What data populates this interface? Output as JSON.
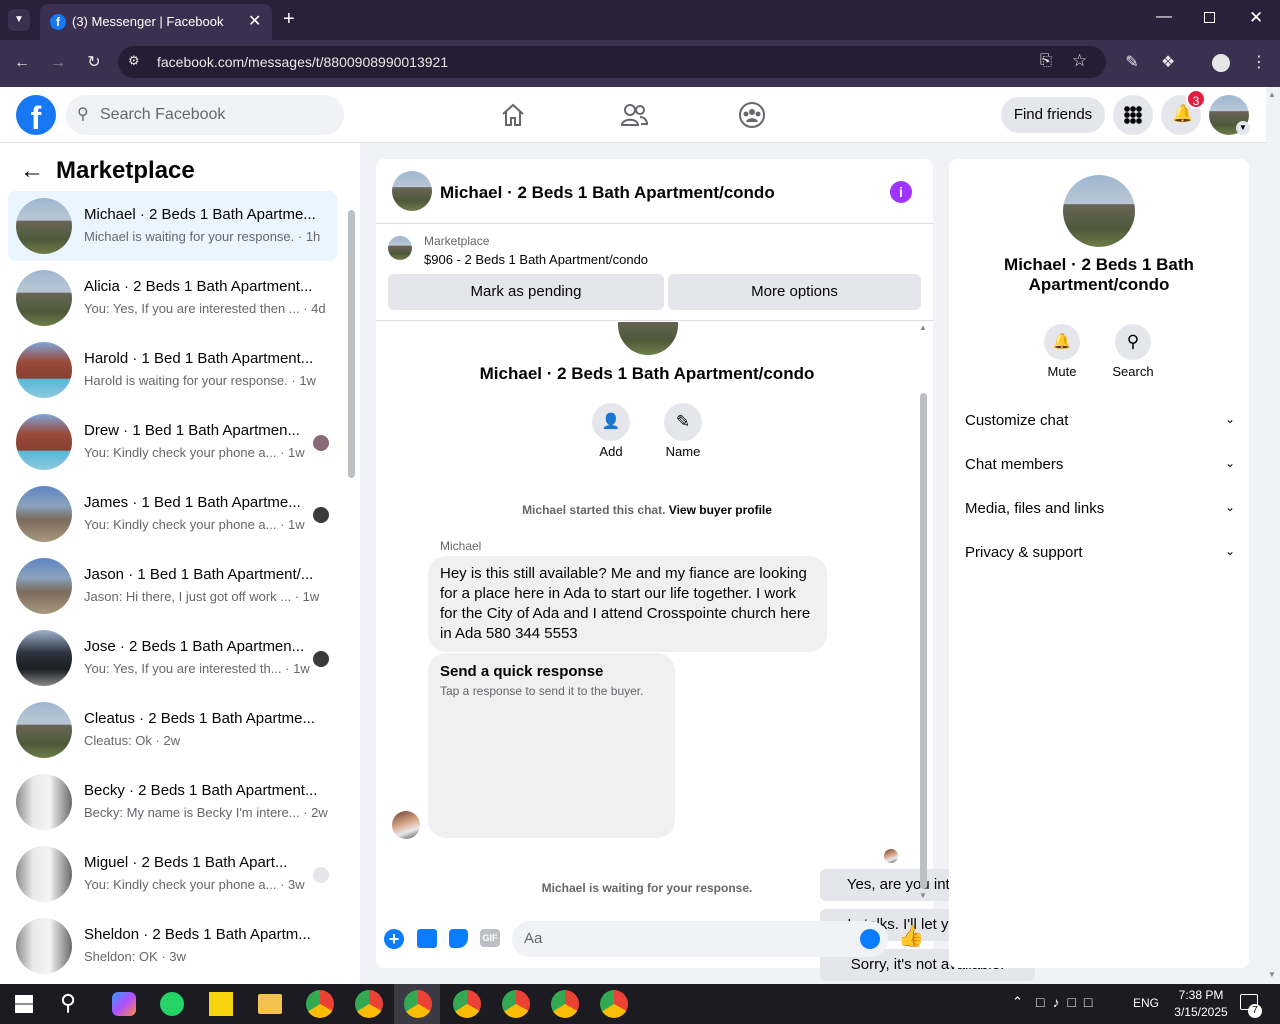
{
  "browser": {
    "tab_title": "(3) Messenger | Facebook",
    "url": "facebook.com/messages/t/8800908990013921"
  },
  "header": {
    "search_placeholder": "Search Facebook",
    "find_friends": "Find friends",
    "notification_count": "3"
  },
  "sidebar": {
    "title": "Marketplace",
    "conversations": [
      {
        "name": "Michael · 2 Beds 1 Bath Apartme...",
        "preview": "Michael is waiting for your response. · 1h",
        "thumb": "house",
        "active": true
      },
      {
        "name": "Alicia · 2 Beds 1 Bath Apartment...",
        "preview": "You: Yes, If you are interested then ...  · 4d",
        "thumb": "house"
      },
      {
        "name": "Harold · 1 Bed 1 Bath Apartment...",
        "preview": "Harold is waiting for your response. · 1w",
        "thumb": "brick"
      },
      {
        "name": "Drew · 1 Bed 1 Bath Apartmen...",
        "preview": "You: Kindly check your phone a... · 1w",
        "thumb": "brick"
      },
      {
        "name": "James · 1 Bed 1 Bath Apartme...",
        "preview": "You: Kindly check your phone a... · 1w",
        "thumb": "street"
      },
      {
        "name": "Jason · 1 Bed 1 Bath Apartment/...",
        "preview": "Jason: Hi there, I just got off work ... · 1w",
        "thumb": "street"
      },
      {
        "name": "Jose · 2 Beds 1 Bath Apartmen...",
        "preview": "You: Yes, If you are interested th... · 1w",
        "thumb": "garage"
      },
      {
        "name": "Cleatus · 2 Beds 1 Bath Apartme...",
        "preview": "Cleatus: Ok · 2w",
        "thumb": "house"
      },
      {
        "name": "Becky · 2 Beds 1 Bath Apartment...",
        "preview": "Becky: My name is Becky I'm intere... · 2w",
        "thumb": "door"
      },
      {
        "name": "Miguel · 2 Beds 1 Bath Apart...",
        "preview": "You: Kindly check your phone a... · 3w",
        "thumb": "door"
      },
      {
        "name": "Sheldon · 2 Beds 1 Bath Apartm...",
        "preview": "Sheldon: OK · 3w",
        "thumb": "door"
      }
    ]
  },
  "chat": {
    "title": "Michael · 2 Beds 1 Bath Apartment/condo",
    "listing_label": "Marketplace",
    "listing_price": "$906 - 2 Beds 1 Bath Apartment/condo",
    "mark_pending": "Mark as pending",
    "more_options": "More options",
    "profile_name": "Michael · 2 Beds 1 Bath Apartment/condo",
    "add_label": "Add",
    "name_label": "Name",
    "started_text": "Michael started this chat.",
    "buyer_profile": "View buyer profile",
    "sender": "Michael",
    "message": "Hey is this still available? Me and my fiance are looking for a place here in Ada to start our life together. I work for the City of Ada and I attend Crosspointe church here in Ada 580 344 5553",
    "quick_title": "Send a quick response",
    "quick_sub": "Tap a response to send it to the buyer.",
    "quick_options": [
      "Yes, are you interested?",
      "In talks. I'll let you know.",
      "Sorry, it's not available."
    ],
    "waiting": "Michael is waiting for your response.",
    "composer_placeholder": "Aa"
  },
  "details": {
    "name": "Michael · 2 Beds 1 Bath Apartment/condo",
    "mute": "Mute",
    "search": "Search",
    "sections": [
      "Customize chat",
      "Chat members",
      "Media, files and links",
      "Privacy & support"
    ]
  },
  "taskbar": {
    "lang": "ENG",
    "time": "7:38 PM",
    "date": "3/15/2025",
    "notif": "7"
  }
}
